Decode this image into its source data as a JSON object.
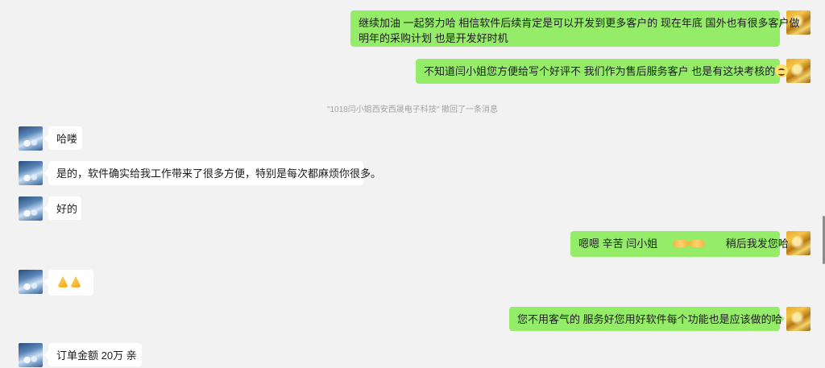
{
  "messages": [
    {
      "side": "right",
      "text_line1": "继续加油 一起努力哈   相信软件后续肯定是可以开发到更多客户的 现在年底 国外也有很多客户做",
      "text_line2": "明年的采购计划  也是开发好时机"
    },
    {
      "side": "right",
      "text": "不知道闫小姐您方便给写个好评不  我们作为售后服务客户 也是有这块考核的",
      "emoji": "smile-emoji"
    },
    {
      "side": "system",
      "text": "\"1018闫小姐西安西晟电子科技\" 撤回了一条消息"
    },
    {
      "side": "left",
      "text": "哈喽"
    },
    {
      "side": "left",
      "text": "是的，软件确实给我工作带来了很多方便，特别是每次都麻烦你很多。"
    },
    {
      "side": "left",
      "text": "好的"
    },
    {
      "side": "right",
      "text_a": "嗯嗯 辛苦 闫小姐",
      "emoji": "handshake-emoji",
      "text_b": "稍后我发您哈"
    },
    {
      "side": "left",
      "emoji": "pray-emoji"
    },
    {
      "side": "right",
      "text": "您不用客气的  服务好您用好软件每个功能也是应该做的哈"
    },
    {
      "side": "left",
      "text": "订单金额  20万 亲"
    }
  ],
  "colors": {
    "background": "#f2f2f2",
    "bubble_right": "#95ec69",
    "bubble_left": "#ffffff",
    "system_text": "#a3a3a3"
  }
}
